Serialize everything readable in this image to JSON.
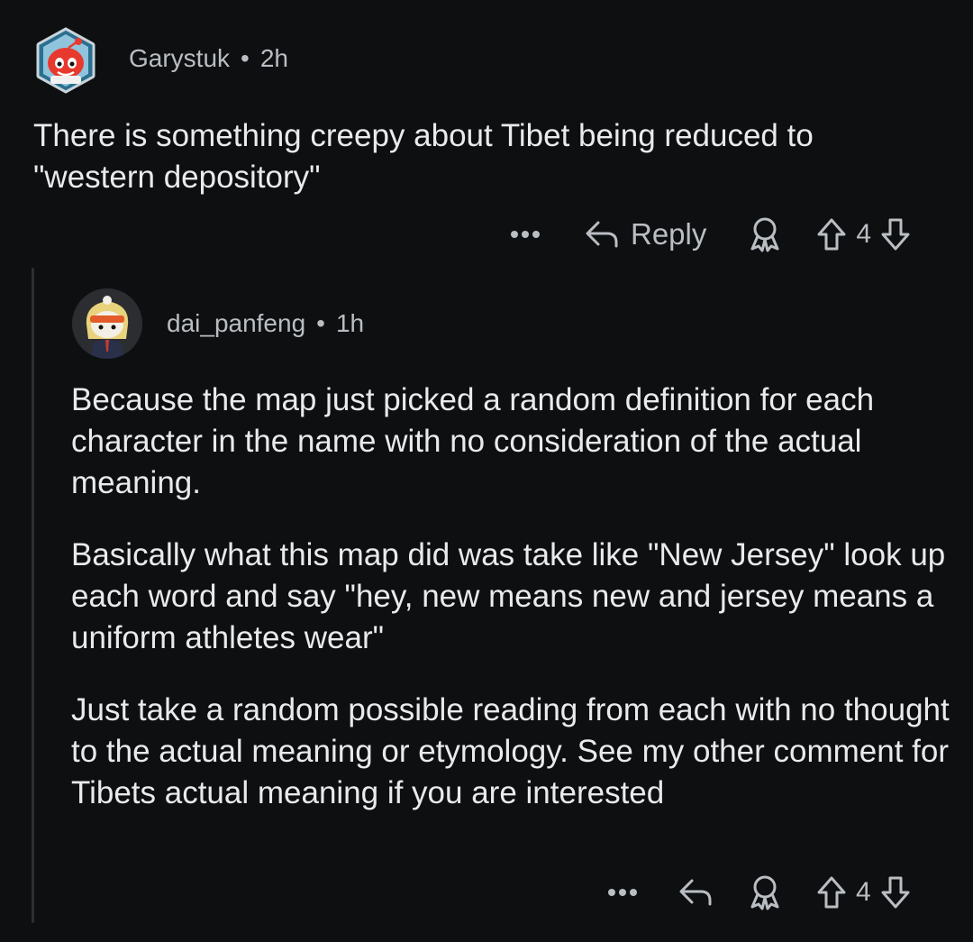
{
  "comments": [
    {
      "user": "Garystuk",
      "separator": "•",
      "time": "2h",
      "text": "There is something  creepy about Tibet being reduced to \"western depository\"",
      "actions": {
        "more": "•••",
        "reply_label": "Reply",
        "votes": "4"
      }
    },
    {
      "user": "dai_panfeng",
      "separator": "•",
      "time": "1h",
      "paragraphs": [
        "Because the map just picked a random definition for each character in the name with no consideration of the actual meaning.",
        "Basically what this map did was take like \"New Jersey\" look up each word and say \"hey, new means new and jersey means a uniform athletes wear\"",
        "Just take a random possible reading from each with no thought to the actual meaning or etymology. See my other comment for Tibets actual meaning if you are interested"
      ],
      "actions": {
        "more": "•••",
        "votes": "4"
      }
    }
  ],
  "icons": [
    "snoo-avatar-icon",
    "more-options-icon",
    "reply-arrow-icon",
    "award-icon",
    "upvote-icon",
    "downvote-icon"
  ],
  "colors": {
    "background": "#0e0f11",
    "text": "#e8eaec",
    "muted": "#b9bec3",
    "thread_line": "#2c2f33",
    "avatar_red": "#e8392e"
  }
}
